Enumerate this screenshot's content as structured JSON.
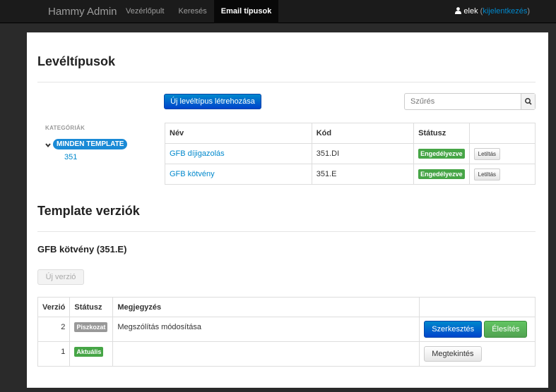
{
  "navbar": {
    "brand": "Hammy Admin",
    "items": [
      {
        "label": "Vezérlőpult",
        "active": false
      },
      {
        "label": "Keresés",
        "active": false
      },
      {
        "label": "Email típusok",
        "active": true
      }
    ],
    "user": {
      "icon": "user-icon",
      "name": "elek",
      "open_paren": " (",
      "logout_label": "kijelentkezés",
      "close_paren": ")"
    }
  },
  "mailtypes": {
    "title": "Levéltípusok",
    "new_button": "Új levéltípus létrehozása",
    "filter": {
      "placeholder": "Szűrés",
      "icon": "search-icon"
    },
    "categories": {
      "label": "KATEGÓRIÁK",
      "icon": "chevron-down-icon",
      "all_label": "MINDEN TEMPLATE",
      "items": [
        "351"
      ]
    },
    "table": {
      "headers": [
        "Név",
        "Kód",
        "Státusz",
        ""
      ],
      "rows": [
        {
          "name": "GFB díjigazolás",
          "code": "351.DI",
          "status": "Engedélyezve",
          "action": "Letiltás"
        },
        {
          "name": "GFB kötvény",
          "code": "351.E",
          "status": "Engedélyezve",
          "action": "Letiltás"
        }
      ]
    }
  },
  "versions": {
    "title": "Template verziók",
    "subtitle": "GFB kötvény (351.E)",
    "new_button": "Új verzió",
    "table": {
      "headers": [
        "Verzió",
        "Státusz",
        "Megjegyzés",
        ""
      ],
      "rows": [
        {
          "version": "2",
          "status": "Piszkozat",
          "note": "Megszólítás módosítása",
          "actions": [
            "Szerkesztés",
            "Élesítés"
          ]
        },
        {
          "version": "1",
          "status": "Aktuális",
          "note": "",
          "actions": [
            "Megtekintés"
          ]
        }
      ]
    }
  },
  "colors": {
    "navbar_bg": "#1b1b1b",
    "link": "#0088cc",
    "primary": "#0055cc",
    "success": "#46a546",
    "draft": "#999999"
  }
}
